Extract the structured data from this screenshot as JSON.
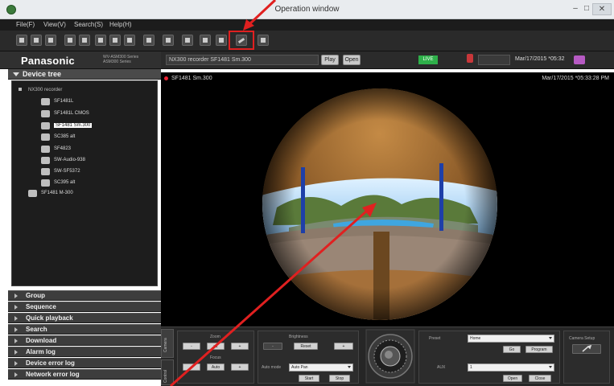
{
  "window": {
    "title": "Operation window",
    "min": "–",
    "max": "□",
    "close": "✕"
  },
  "menu": [
    "File(F)",
    "View(V)",
    "Search(S)",
    "Help(H)"
  ],
  "brand": {
    "name": "Panasonic",
    "sub_line1": "WV-ASM300 Series",
    "sub_line2": "ASM300 Series"
  },
  "status": {
    "camera_field": "NX300 recorder SF1481 Sm.300",
    "play_label": "Play",
    "open_label": "Open",
    "live_label": "LIVE",
    "datetime": "Mar/17/2015 *05:32"
  },
  "tree": {
    "header": "Device tree",
    "root": "NX300 recorder",
    "nodes": [
      "SF1481L",
      "SF1481L CMOS",
      "SF1481 Sm.300",
      "SC385 alt",
      "SF4823",
      "SW-Audio-938",
      "SW-SF5372",
      "SC395 alt",
      "SF1481 M-300"
    ],
    "selected_index": 2
  },
  "panels": [
    "Group",
    "Sequence",
    "Quick playback",
    "Search",
    "Download",
    "Alarm log",
    "Device error log",
    "Network error log"
  ],
  "viewer": {
    "title": "SF1481 Sm.300",
    "timestamp": "Mar/17/2015 *05:33:28 PM"
  },
  "controls": {
    "tabs": [
      "Camera",
      "Control"
    ],
    "zoom_label": "Zoom",
    "focus_label": "Focus",
    "brightness_label": "Brightness",
    "reset_label": "Reset",
    "auto_label": "Auto",
    "auto_mode_label": "Auto mode",
    "auto_mode_value": "Auto Pan",
    "start_label": "Start",
    "stop_label": "Stop",
    "preset_label": "Preset",
    "preset_value": "Home",
    "go_label": "Go",
    "program_label": "Program",
    "aux_label": "AUX",
    "aux_value": "1",
    "open_label": "Open",
    "close_label": "Close",
    "camera_setup_label": "Camera Setup",
    "minus": "-",
    "plus": "+",
    "x1": "x1"
  }
}
